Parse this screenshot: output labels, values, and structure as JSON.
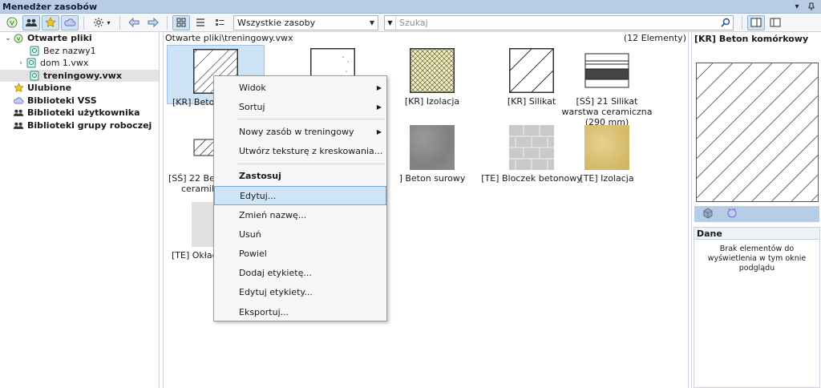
{
  "window": {
    "title": "Menedżer zasobów"
  },
  "toolbar": {
    "filter_value": "Wszystkie zasoby",
    "search_placeholder": "Szukaj"
  },
  "tree": {
    "open_files": "Otwarte pliki",
    "files": [
      "Bez nazwy1",
      "dom 1.vwx",
      "treningowy.vwx"
    ],
    "favorites": "Ulubione",
    "vss": "Biblioteki VSS",
    "user_libs": "Biblioteki użytkownika",
    "group_libs": "Biblioteki grupy roboczej"
  },
  "center": {
    "path": "Otwarte pliki\\treningowy.vwx",
    "count": "(12 Elementy)",
    "items": [
      "[KR] Beton",
      "",
      "[KR] Izolacja",
      "[KR] Silikat",
      "[SŚ] 21 Silikat warstwa ceramiczna (290 mm)",
      "[SŚ] 22 Beton",
      "ceramika",
      "] Beton surowy",
      "[TE] Bloczek betonowy",
      "[TE] Izolacja",
      "[TE] Okładz"
    ]
  },
  "context_menu": {
    "items": [
      "Widok",
      "Sortuj",
      "Nowy zasób w treningowy",
      "Utwórz teksturę z kreskowania...",
      "Zastosuj",
      "Edytuj...",
      "Zmień nazwę...",
      "Usuń",
      "Powiel",
      "Dodaj etykietę...",
      "Edytuj etykiety...",
      "Eksportuj..."
    ]
  },
  "preview": {
    "title": "[KR] Beton komórkowy",
    "data_header": "Dane",
    "data_text": "Brak elementów do wyświetlenia w tym oknie podglądu"
  }
}
